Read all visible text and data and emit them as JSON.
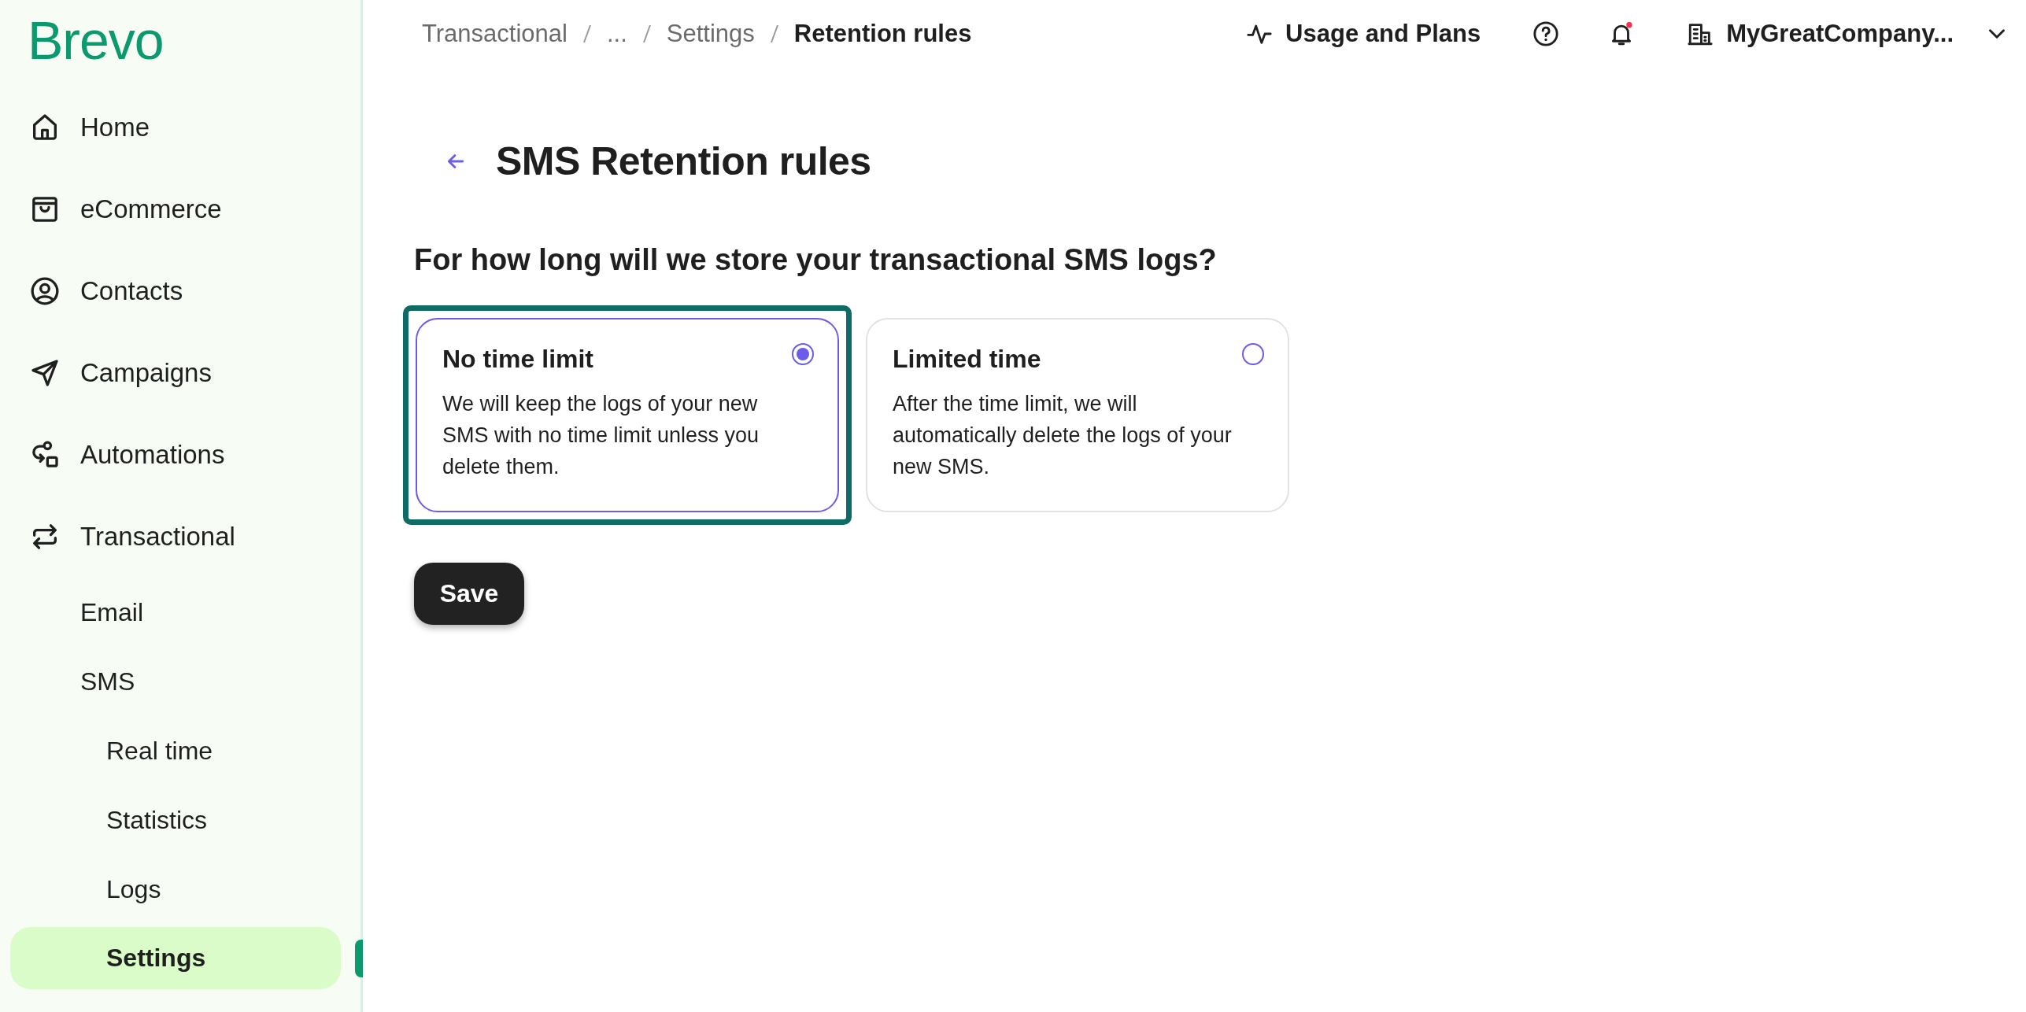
{
  "brand": {
    "logo": "Brevo"
  },
  "sidebar": {
    "items": [
      {
        "label": "Home",
        "selected": false
      },
      {
        "label": "eCommerce",
        "selected": false
      },
      {
        "label": "Contacts",
        "selected": false
      },
      {
        "label": "Campaigns",
        "selected": false
      },
      {
        "label": "Automations",
        "selected": false
      },
      {
        "label": "Transactional",
        "selected": false,
        "children": [
          {
            "label": "Email",
            "selected": false
          },
          {
            "label": "SMS",
            "selected": false,
            "children": [
              {
                "label": "Real time",
                "selected": false
              },
              {
                "label": "Statistics",
                "selected": false
              },
              {
                "label": "Logs",
                "selected": false
              },
              {
                "label": "Settings",
                "selected": true
              }
            ]
          }
        ]
      }
    ]
  },
  "breadcrumb": [
    {
      "label": "Transactional",
      "current": false
    },
    {
      "label": "...",
      "current": false
    },
    {
      "label": "Settings",
      "current": false
    },
    {
      "label": "Retention rules",
      "current": true
    }
  ],
  "header": {
    "usage": "Usage and Plans",
    "notifications": {
      "unread": true
    },
    "account": "MyGreatCompany..."
  },
  "page": {
    "title": "SMS Retention rules",
    "question": "For how long will we store your transactional SMS logs?",
    "options": [
      {
        "title": "No time limit",
        "description": "We will keep the logs of your new SMS with no time limit unless you delete them.",
        "selected": true,
        "focused": true
      },
      {
        "title": "Limited time",
        "description": "After the time limit, we will automatically delete the logs of your new SMS.",
        "selected": false,
        "focused": false
      }
    ],
    "save": "Save"
  }
}
